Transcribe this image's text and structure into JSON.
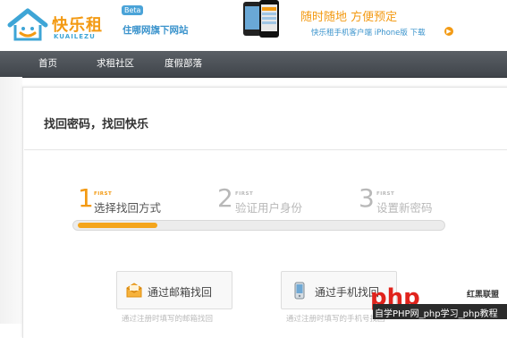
{
  "header": {
    "logo_cn": "快乐租",
    "logo_en": "KUAILEZU",
    "logo_beta": "Beta",
    "slogan": "住哪网旗下网站",
    "promo_title": "随时随地 方便预定",
    "promo_link": "快乐租手机客户端 iPhone版 下载",
    "brand_color": "#f39a13",
    "accent_color": "#3a93cc"
  },
  "nav": {
    "items": [
      {
        "label": "首页"
      },
      {
        "label": "求租社区"
      },
      {
        "label": "度假部落"
      }
    ]
  },
  "main": {
    "title": "找回密码，找回快乐",
    "steps": [
      {
        "num": "1",
        "first": "FIRST",
        "label": "选择找回方式",
        "state": "active"
      },
      {
        "num": "2",
        "first": "FIRST",
        "label": "验证用户身份",
        "state": "inactive"
      },
      {
        "num": "3",
        "first": "FIRST",
        "label": "设置新密码",
        "state": "inactive"
      }
    ],
    "progress_fraction": 0.22,
    "options": [
      {
        "label": "通过邮箱找回",
        "icon": "envelope-icon",
        "hint": "通过注册时填写的邮箱找回"
      },
      {
        "label": "通过手机找回",
        "icon": "mobile-phone-icon",
        "hint": "通过注册时填写的手机号找回"
      }
    ]
  },
  "watermark": {
    "logo_text": "php",
    "brand": "红黑联盟",
    "bar_text": "自学PHP网_php学习_php教程"
  }
}
